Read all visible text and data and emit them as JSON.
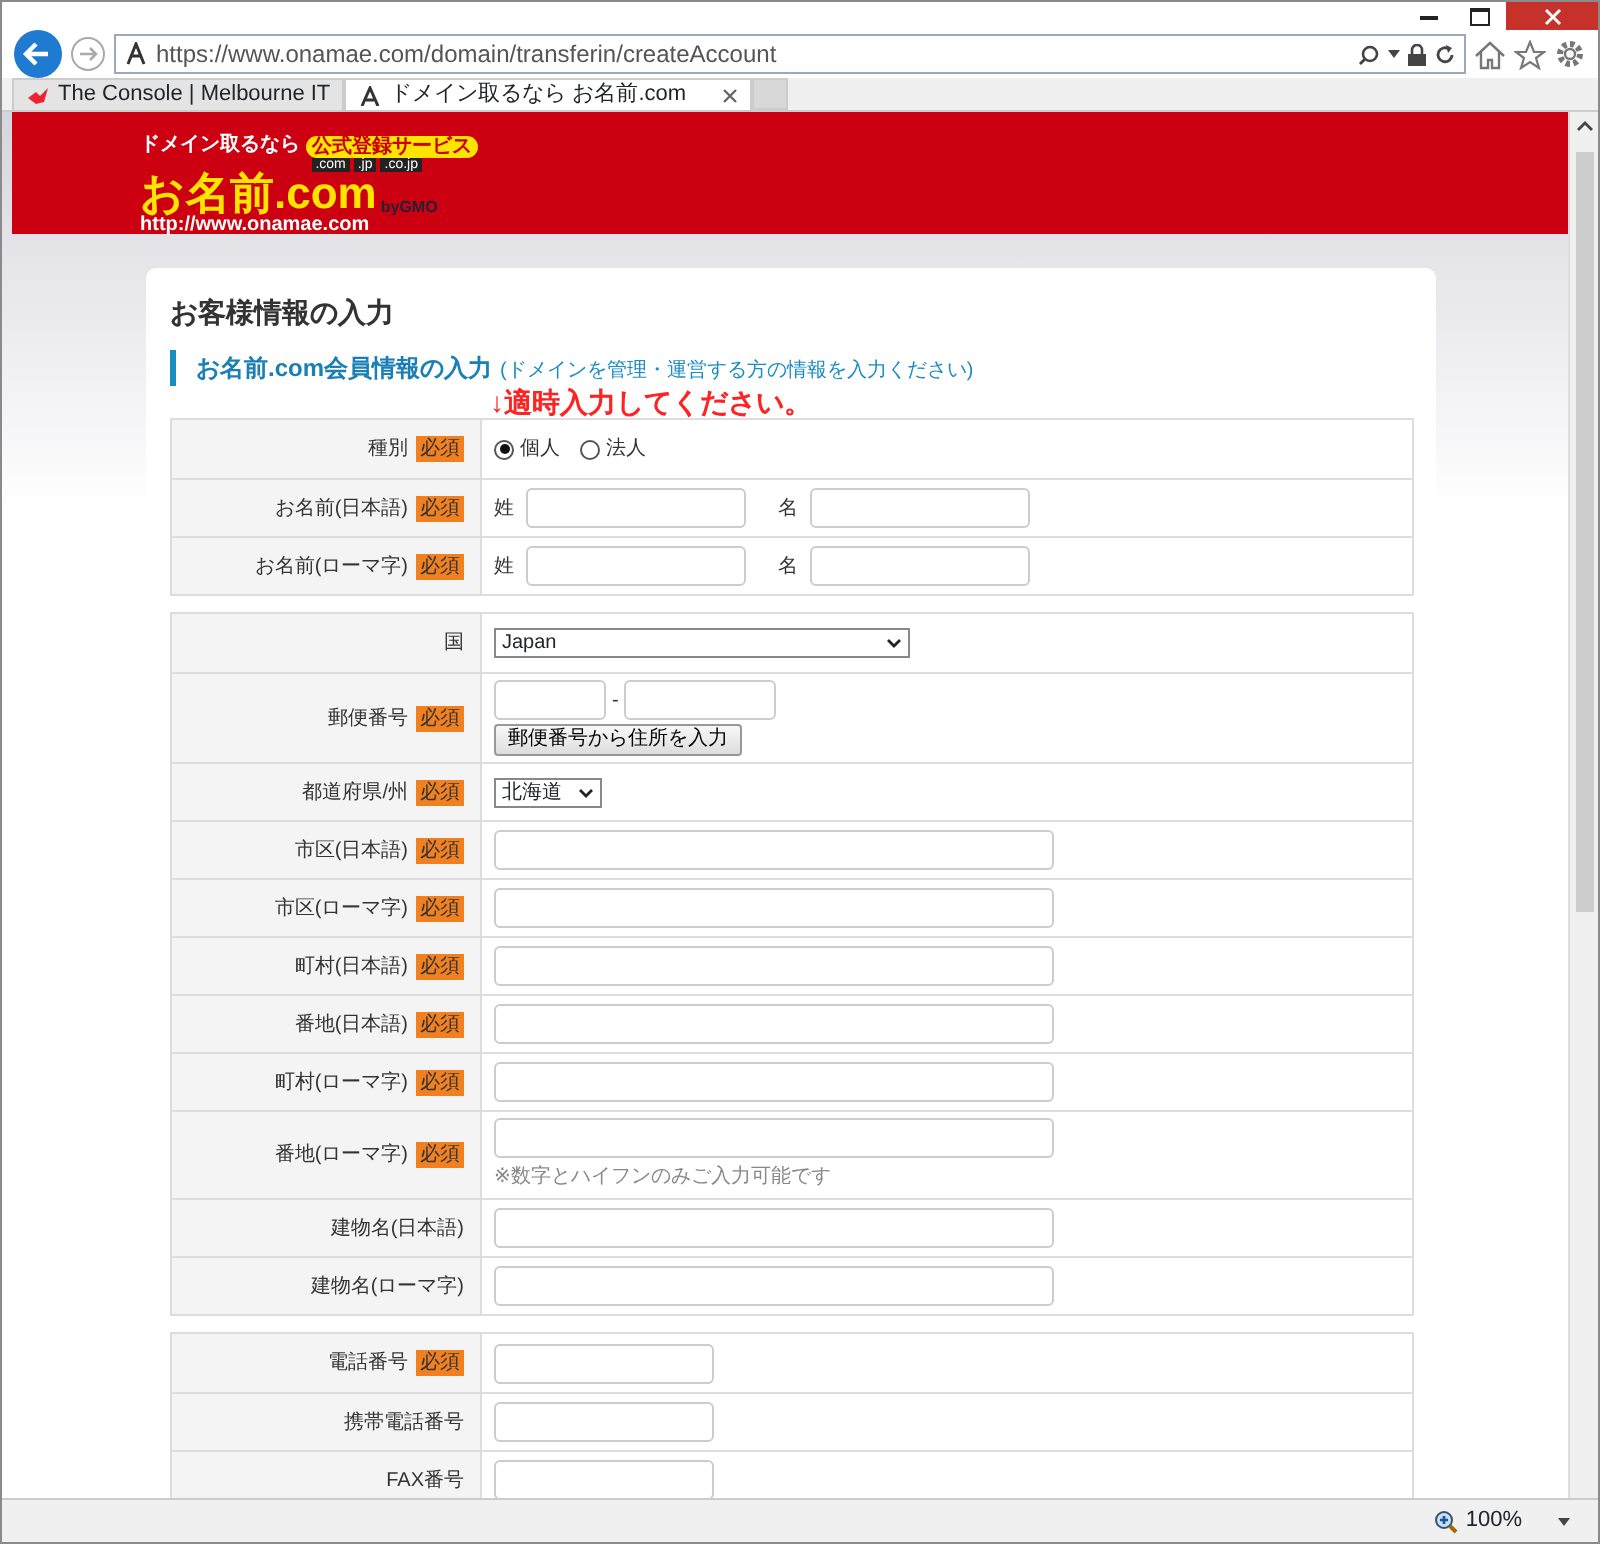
{
  "browser": {
    "address_url": "https://www.onamae.com/domain/transferin/createAccount",
    "tabs": [
      {
        "title": "The Console | Melbourne IT",
        "selected": false
      },
      {
        "title": "ドメイン取るなら お名前.com",
        "selected": true
      }
    ],
    "zoom": "100%"
  },
  "banner": {
    "logo_tagline": "ドメイン取るなら",
    "logo_badge": "公式登録サービス",
    "logo_tlds": [
      ".com",
      ".jp",
      ".co.jp"
    ],
    "logo_name": "お名前.com",
    "logo_by": "byGMO",
    "logo_url": "http://www.onamae.com"
  },
  "form": {
    "title": "お客様情報の入力",
    "section_heading": "お名前.com会員情報の入力",
    "section_note": "(ドメインを管理・運営する方の情報を入力ください)",
    "annotation": "↓適時入力してください。",
    "groups": [
      {
        "rows": [
          {
            "label": "種別",
            "badge": "必須",
            "kind": "radio",
            "options": [
              {
                "label": "個人",
                "selected": true
              },
              {
                "label": "法人",
                "selected": false
              }
            ]
          },
          {
            "label": "お名前(日本語)",
            "badge": "必須",
            "kind": "pair",
            "parts": [
              "姓",
              "名"
            ]
          },
          {
            "label": "お名前(ローマ字)",
            "badge": "必須",
            "kind": "pair",
            "parts": [
              "姓",
              "名"
            ]
          }
        ]
      },
      {
        "rows": [
          {
            "label": "国",
            "kind": "wideselect",
            "value": "Japan"
          },
          {
            "label": "郵便番号",
            "badge": "必須",
            "kind": "postal",
            "separator": "-",
            "button": "郵便番号から住所を入力"
          },
          {
            "label": "都道府県/州",
            "badge": "必須",
            "kind": "narrowselect",
            "value": "北海道"
          },
          {
            "label": "市区(日本語)",
            "badge": "必須",
            "kind": "longtext"
          },
          {
            "label": "市区(ローマ字)",
            "badge": "必須",
            "kind": "longtext"
          },
          {
            "label": "町村(日本語)",
            "badge": "必須",
            "kind": "longtext"
          },
          {
            "label": "番地(日本語)",
            "badge": "必須",
            "kind": "longtext"
          },
          {
            "label": "町村(ローマ字)",
            "badge": "必須",
            "kind": "longtext"
          },
          {
            "label": "番地(ローマ字)",
            "badge": "必須",
            "kind": "longtext",
            "note": "※数字とハイフンのみご入力可能です"
          },
          {
            "label": "建物名(日本語)",
            "kind": "longtext"
          },
          {
            "label": "建物名(ローマ字)",
            "kind": "longtext"
          }
        ]
      },
      {
        "rows": [
          {
            "label": "電話番号",
            "badge": "必須",
            "kind": "shorttext"
          },
          {
            "label": "携帯電話番号",
            "kind": "shorttext"
          },
          {
            "label": "FAX番号",
            "kind": "shorttext"
          }
        ]
      }
    ]
  }
}
